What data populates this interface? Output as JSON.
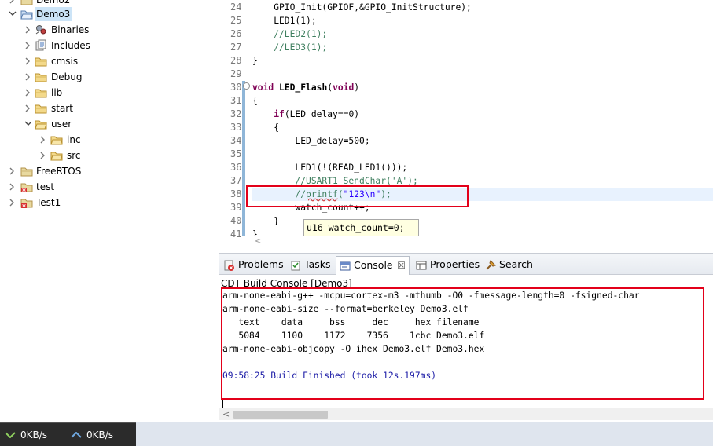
{
  "tree": {
    "items": [
      {
        "label": "Demo2",
        "depth": 0,
        "kind": "project",
        "expanded": false,
        "selected": false
      },
      {
        "label": "Demo3",
        "depth": 0,
        "kind": "project-open",
        "expanded": true,
        "selected": true
      },
      {
        "label": "Binaries",
        "depth": 1,
        "kind": "binaries",
        "expanded": false,
        "selected": false
      },
      {
        "label": "Includes",
        "depth": 1,
        "kind": "includes",
        "expanded": false,
        "selected": false
      },
      {
        "label": "cmsis",
        "depth": 1,
        "kind": "folder",
        "expanded": false,
        "selected": false
      },
      {
        "label": "Debug",
        "depth": 1,
        "kind": "folder",
        "expanded": false,
        "selected": false
      },
      {
        "label": "lib",
        "depth": 1,
        "kind": "folder",
        "expanded": false,
        "selected": false
      },
      {
        "label": "start",
        "depth": 1,
        "kind": "folder",
        "expanded": false,
        "selected": false
      },
      {
        "label": "user",
        "depth": 1,
        "kind": "folder",
        "expanded": true,
        "selected": false
      },
      {
        "label": "inc",
        "depth": 2,
        "kind": "folder",
        "expanded": false,
        "selected": false
      },
      {
        "label": "src",
        "depth": 2,
        "kind": "folder",
        "expanded": false,
        "selected": false
      },
      {
        "label": "FreeRTOS",
        "depth": 0,
        "kind": "project",
        "expanded": false,
        "selected": false
      },
      {
        "label": "test",
        "depth": 0,
        "kind": "project-err",
        "expanded": false,
        "selected": false
      },
      {
        "label": "Test1",
        "depth": 0,
        "kind": "project-err",
        "expanded": false,
        "selected": false
      }
    ]
  },
  "editor": {
    "lines": [
      {
        "num": "24",
        "text": "    GPIO_Init(GPIOF,&GPIO_InitStructure);"
      },
      {
        "num": "25",
        "text": "    LED1(1);"
      },
      {
        "num": "26",
        "text": "    //LED2(1);"
      },
      {
        "num": "27",
        "text": "    //LED3(1);"
      },
      {
        "num": "28",
        "text": "}"
      },
      {
        "num": "29",
        "text": ""
      },
      {
        "num": "30",
        "text": "void LED_Flash(void)"
      },
      {
        "num": "31",
        "text": "{"
      },
      {
        "num": "32",
        "text": "    if(LED_delay==0)"
      },
      {
        "num": "33",
        "text": "    {"
      },
      {
        "num": "34",
        "text": "        LED_delay=500;"
      },
      {
        "num": "35",
        "text": ""
      },
      {
        "num": "36",
        "text": "        LED1(!(READ_LED1()));"
      },
      {
        "num": "37",
        "text": "        //USART1_SendChar('A');"
      },
      {
        "num": "38",
        "text": "        //printf(\"123\\n\");"
      },
      {
        "num": "39",
        "text": "        watch_count++;"
      },
      {
        "num": "40",
        "text": "    }"
      },
      {
        "num": "41",
        "text": "}"
      }
    ],
    "hover_tip": "u16 watch_count=0;"
  },
  "panel": {
    "tabs": [
      {
        "label": "Problems",
        "icon": "problems-icon"
      },
      {
        "label": "Tasks",
        "icon": "tasks-icon"
      },
      {
        "label": "Console",
        "icon": "console-icon",
        "active": true,
        "close": "☒"
      },
      {
        "label": "Properties",
        "icon": "properties-icon"
      },
      {
        "label": "Search",
        "icon": "search-icon"
      }
    ],
    "console_title": "CDT Build Console [Demo3]",
    "console_lines": [
      "arm-none-eabi-g++ -mcpu=cortex-m3 -mthumb -O0 -fmessage-length=0 -fsigned-char",
      "arm-none-eabi-size --format=berkeley Demo3.elf",
      "   text    data     bss     dec     hex filename",
      "   5084    1100    1172    7356    1cbc Demo3.elf",
      "arm-none-eabi-objcopy -O ihex Demo3.elf Demo3.hex",
      "",
      "09:58:25 Build Finished (took 12s.197ms)"
    ]
  },
  "netbar": {
    "down": "0KB/s",
    "up": "0KB/s"
  },
  "colors": {
    "keyword": "#7f0055",
    "comment": "#3f7f5f",
    "string": "#2a00ff",
    "annotation": "#e3001a",
    "build_finished": "#1a1aa6"
  }
}
